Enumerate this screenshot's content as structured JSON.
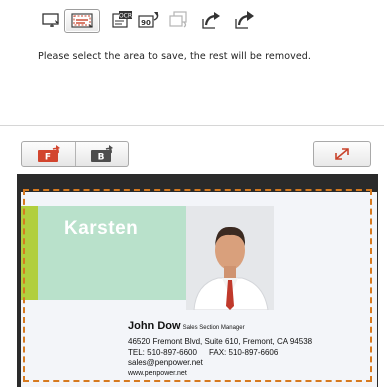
{
  "toolbar": {
    "icons": [
      "crop-icon",
      "select-area-icon",
      "ocr-icon",
      "rotate-90-icon",
      "copy-icon",
      "rotate-left-icon",
      "rotate-right-icon"
    ],
    "ocr_label": "OCR",
    "rotate90_label": "90"
  },
  "instruction": "Please select the area to save, the rest will be removed.",
  "side_toggle": {
    "front_label": "F",
    "back_label": "B",
    "front_color": "#d2452e",
    "back_color": "#4d4d4d"
  },
  "card": {
    "brand": "Karsten",
    "name": "John Dow",
    "title": "Sales Section Manager",
    "address": "46520 Fremont Blvd, Suite 610, Fremont, CA 94538",
    "tel": "TEL: 510-897-6600",
    "fax": "FAX: 510-897-6606",
    "email": "sales@penpower.net",
    "website": "www.penpower.net"
  },
  "colors": {
    "accent": "#c9432b",
    "selection_border": "#d77a1f",
    "card_green": "#b9e1cb",
    "card_lime": "#b1cf3e"
  }
}
